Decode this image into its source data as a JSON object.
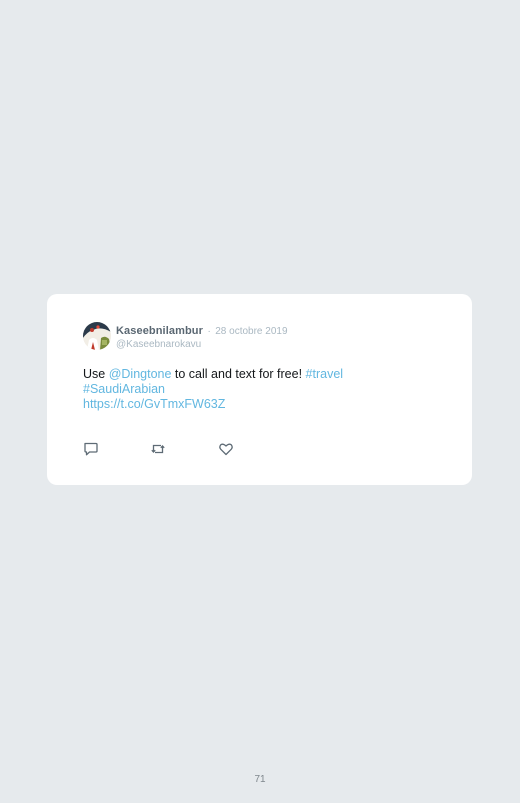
{
  "tweet": {
    "author_name": "Kaseebnilambur",
    "separator": "·",
    "date": "28 octobre 2019",
    "handle": "@Kaseebnarokavu",
    "text_parts": [
      {
        "text": "Use ",
        "type": "text"
      },
      {
        "text": "@Dingtone",
        "type": "mention"
      },
      {
        "text": " to call and text for free! ",
        "type": "text"
      },
      {
        "text": "#travel",
        "type": "hashtag"
      },
      {
        "text": "#SaudiArabian",
        "type": "hashtag"
      },
      {
        "text": "https://t.co/GvTmxFW63Z",
        "type": "url"
      }
    ],
    "actions": [
      {
        "name": "reply",
        "icon": "reply-icon"
      },
      {
        "name": "retweet",
        "icon": "retweet-icon"
      },
      {
        "name": "like",
        "icon": "heart-icon"
      }
    ]
  },
  "page": {
    "number": "71"
  },
  "colors": {
    "background": "#e6eaed",
    "card": "#ffffff",
    "link": "#62b7e0",
    "muted": "#aab8c2",
    "name": "#5a6772"
  }
}
